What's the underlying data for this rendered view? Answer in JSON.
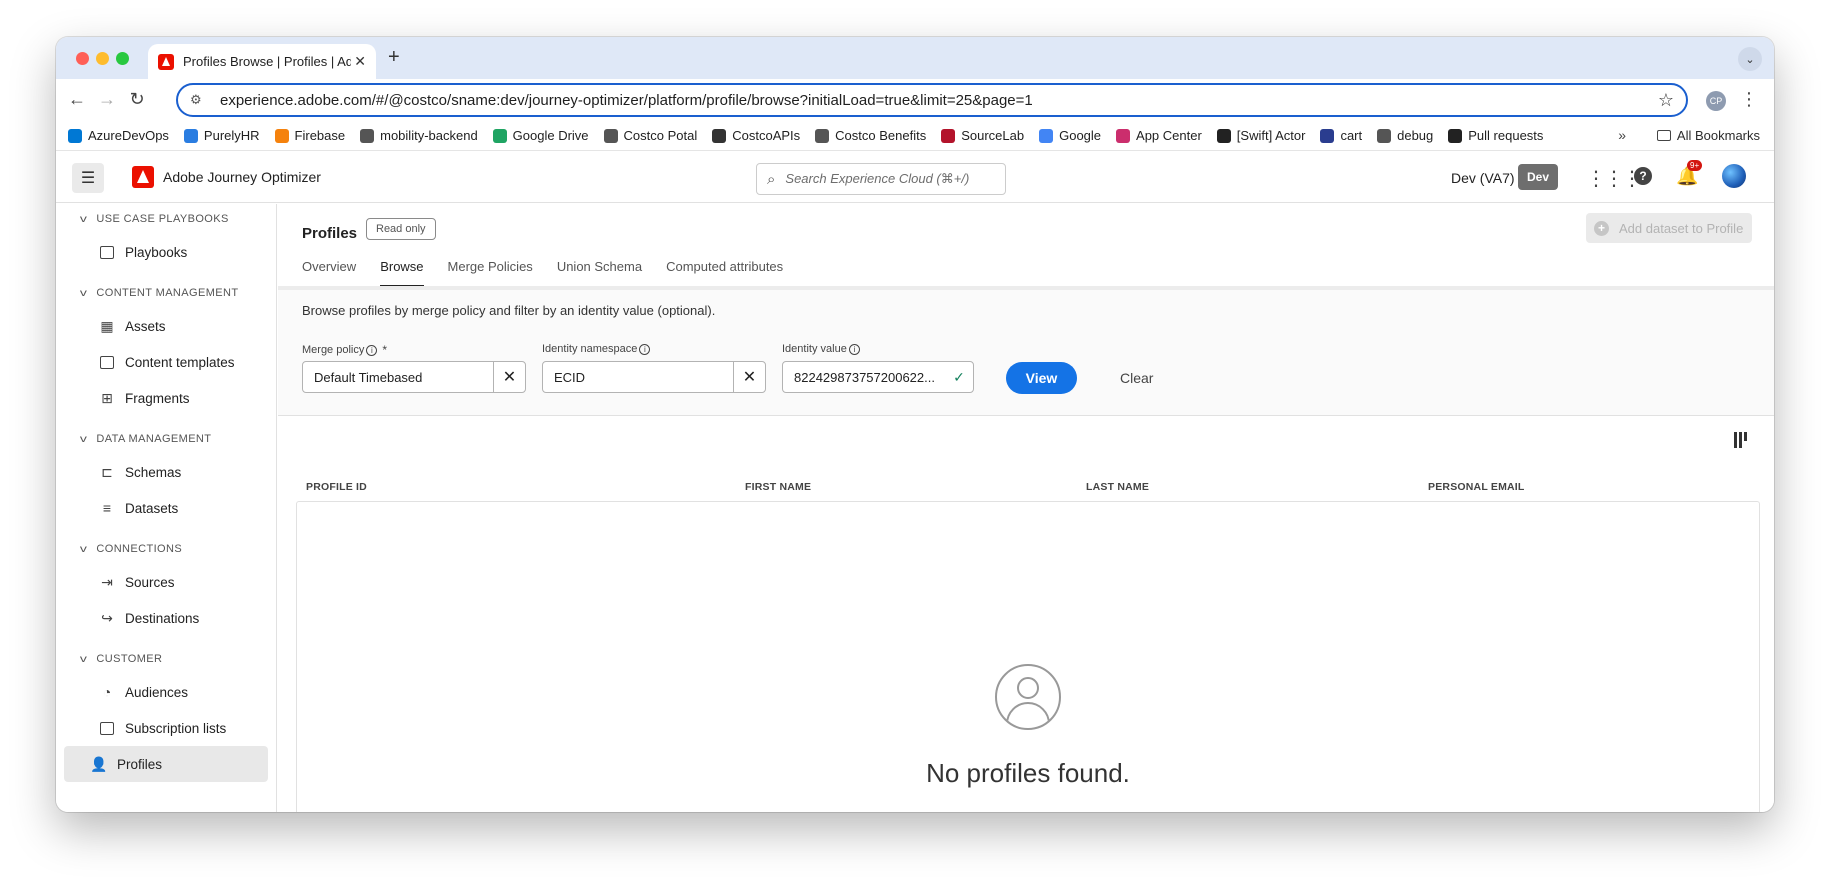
{
  "browser": {
    "tab_title": "Profiles Browse | Profiles | Ad",
    "url": "experience.adobe.com/#/@costco/sname:dev/journey-optimizer/platform/profile/browse?initialLoad=true&limit=25&page=1",
    "profile_initials": "CP",
    "bookmarks": [
      {
        "label": "AzureDevOps",
        "color": "#0078d4"
      },
      {
        "label": "PurelyHR",
        "color": "#2a7de1"
      },
      {
        "label": "Firebase",
        "color": "#f5820d"
      },
      {
        "label": "mobility-backend",
        "color": "#555555"
      },
      {
        "label": "Google Drive",
        "color": "#1fa463"
      },
      {
        "label": "Costco Potal",
        "color": "#555555"
      },
      {
        "label": "CostcoAPIs",
        "color": "#333333"
      },
      {
        "label": "Costco Benefits",
        "color": "#555555"
      },
      {
        "label": "SourceLab",
        "color": "#b3132b"
      },
      {
        "label": "Google",
        "color": "#4285f4"
      },
      {
        "label": "App Center",
        "color": "#cb2e6d"
      },
      {
        "label": "[Swift] Actor",
        "color": "#222222"
      },
      {
        "label": "cart",
        "color": "#2a3d8f"
      },
      {
        "label": "debug",
        "color": "#555555"
      },
      {
        "label": "Pull requests",
        "color": "#222222"
      }
    ],
    "bookmarks_more": "»",
    "all_bookmarks": "All Bookmarks"
  },
  "app": {
    "name": "Adobe Journey Optimizer",
    "search_placeholder": "Search Experience Cloud (⌘+/)",
    "environment": "Dev (VA7)",
    "env_badge": "Dev",
    "notification_count": "9+"
  },
  "sidebar": {
    "sections": [
      {
        "title": "USE CASE PLAYBOOKS",
        "items": [
          "Playbooks"
        ]
      },
      {
        "title": "CONTENT MANAGEMENT",
        "items": [
          "Assets",
          "Content templates",
          "Fragments"
        ]
      },
      {
        "title": "DATA MANAGEMENT",
        "items": [
          "Schemas",
          "Datasets"
        ]
      },
      {
        "title": "CONNECTIONS",
        "items": [
          "Sources",
          "Destinations"
        ]
      },
      {
        "title": "CUSTOMER",
        "items": [
          "Audiences",
          "Subscription lists",
          "Profiles"
        ]
      }
    ]
  },
  "page": {
    "title": "Profiles",
    "read_only": "Read only",
    "add_dataset": "Add dataset to Profile",
    "tabs": [
      "Overview",
      "Browse",
      "Merge Policies",
      "Union Schema",
      "Computed attributes"
    ],
    "active_tab": "Browse",
    "description": "Browse profiles by merge policy and filter by an identity value (optional).",
    "filters": {
      "merge_policy_label": "Merge policy",
      "merge_policy_value": "Default Timebased",
      "identity_namespace_label": "Identity namespace",
      "identity_namespace_value": "ECID",
      "identity_value_label": "Identity value",
      "identity_value": "822429873757200622..."
    },
    "view_button": "View",
    "clear_button": "Clear",
    "table": {
      "columns": [
        "PROFILE ID",
        "FIRST NAME",
        "LAST NAME",
        "PERSONAL EMAIL"
      ]
    },
    "empty_state": "No profiles found."
  }
}
